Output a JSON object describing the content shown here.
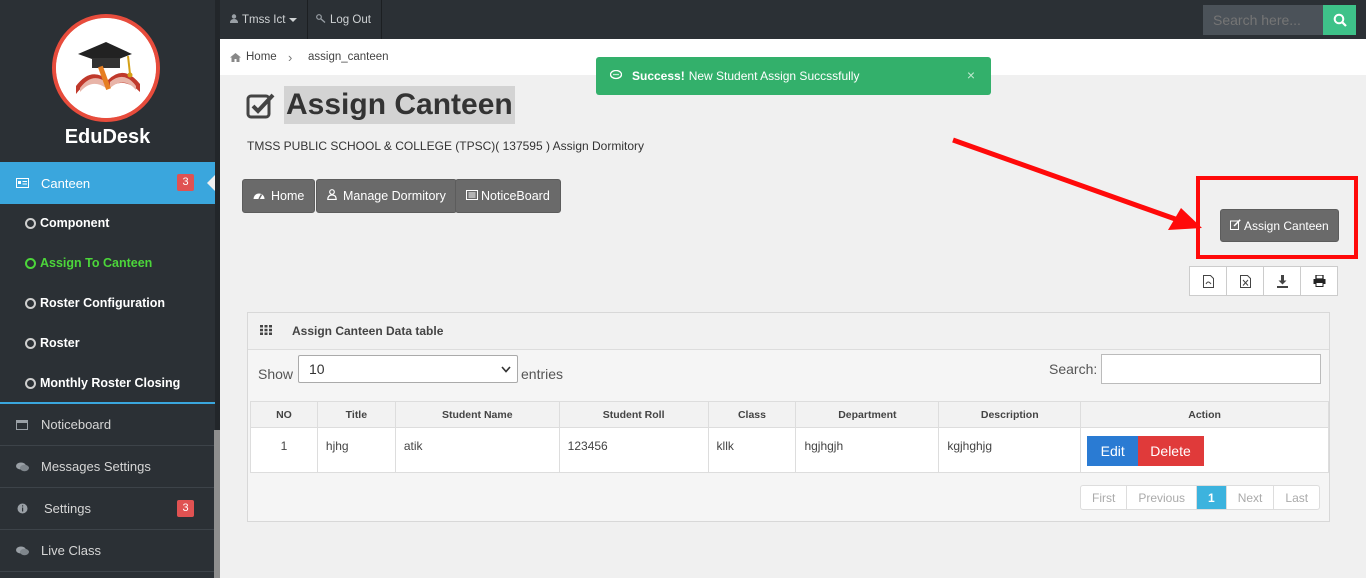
{
  "sidebar": {
    "brand": "EduDesk",
    "active_item": {
      "label": "Canteen",
      "badge": "3"
    },
    "sub_items": [
      {
        "label": "Component"
      },
      {
        "label": "Assign To Canteen"
      },
      {
        "label": "Roster Configuration"
      },
      {
        "label": "Roster"
      },
      {
        "label": "Monthly Roster Closing"
      }
    ],
    "items": [
      {
        "label": "Noticeboard"
      },
      {
        "label": "Messages Settings"
      },
      {
        "label": "Settings",
        "badge": "3"
      },
      {
        "label": "Live Class"
      }
    ]
  },
  "topbar": {
    "user": "Tmss Ict",
    "logout": "Log Out",
    "search_placeholder": "Search here..."
  },
  "breadcrumb": {
    "home": "Home",
    "current": "assign_canteen"
  },
  "alert": {
    "strong": "Success!",
    "message": "New Student Assign Succssfully",
    "close": "×"
  },
  "page": {
    "title": "Assign Canteen",
    "subtitle": "TMSS PUBLIC SCHOOL & COLLEGE (TPSC)( 137595 ) Assign Dormitory",
    "buttons": {
      "home": "Home",
      "manage_dormitory": "Manage Dormitory",
      "noticeboard": "NoticeBoard"
    },
    "assign_button": "Assign Canteen"
  },
  "panel": {
    "title": "Assign Canteen Data table",
    "show_label": "Show",
    "entries_value": "10",
    "entries_label": "entries",
    "search_label": "Search:",
    "columns": [
      "NO",
      "Title",
      "Student Name",
      "Student Roll",
      "Class",
      "Department",
      "Description",
      "Action"
    ],
    "rows": [
      {
        "no": "1",
        "title": "hjhg",
        "student_name": "atik",
        "student_roll": "123456",
        "class": "kllk",
        "department": "hgjhgjh",
        "description": "kgjhghjg"
      }
    ],
    "edit_label": "Edit",
    "delete_label": "Delete",
    "pager": {
      "first": "First",
      "previous": "Previous",
      "page": "1",
      "next": "Next",
      "last": "Last"
    }
  },
  "colors": {
    "sidebar_bg": "#2b3035",
    "accent": "#3aa6dd",
    "success": "#33b06b",
    "annotation": "#ff0a0a"
  }
}
